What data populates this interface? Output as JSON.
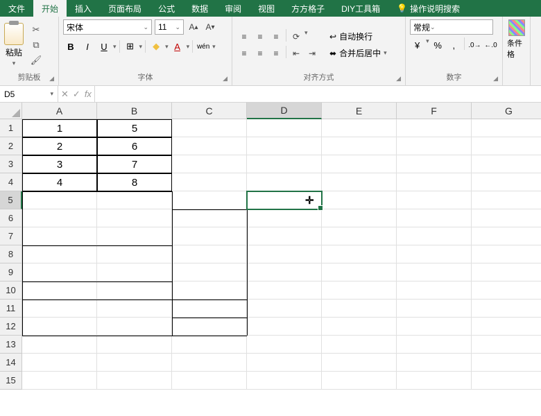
{
  "tabs": [
    "文件",
    "开始",
    "插入",
    "页面布局",
    "公式",
    "数据",
    "审阅",
    "视图",
    "方方格子",
    "DIY工具箱"
  ],
  "activeTab": 1,
  "tellme": "操作说明搜索",
  "ribbon": {
    "clipboard": {
      "paste": "粘贴",
      "label": "剪贴板"
    },
    "font": {
      "name": "宋体",
      "size": "11",
      "label": "字体",
      "bold": "B",
      "italic": "I",
      "underline": "U",
      "pinyin": "wén"
    },
    "align": {
      "wrap": "自动换行",
      "merge": "合并后居中",
      "label": "对齐方式"
    },
    "number": {
      "format": "常规",
      "label": "数字",
      "percent": "%",
      "comma": ",",
      "currency": "¥"
    },
    "cond": {
      "label": "条件格"
    }
  },
  "namebox": "D5",
  "cols": [
    "A",
    "B",
    "C",
    "D",
    "E",
    "F",
    "G"
  ],
  "rows": [
    "1",
    "2",
    "3",
    "4",
    "5",
    "6",
    "7",
    "8",
    "9",
    "10",
    "11",
    "12",
    "13",
    "14",
    "15"
  ],
  "cells": {
    "A1": "1",
    "A2": "2",
    "A3": "3",
    "A4": "4",
    "B1": "5",
    "B2": "6",
    "B3": "7",
    "B4": "8"
  },
  "selected": {
    "col": 3,
    "row": 4
  }
}
